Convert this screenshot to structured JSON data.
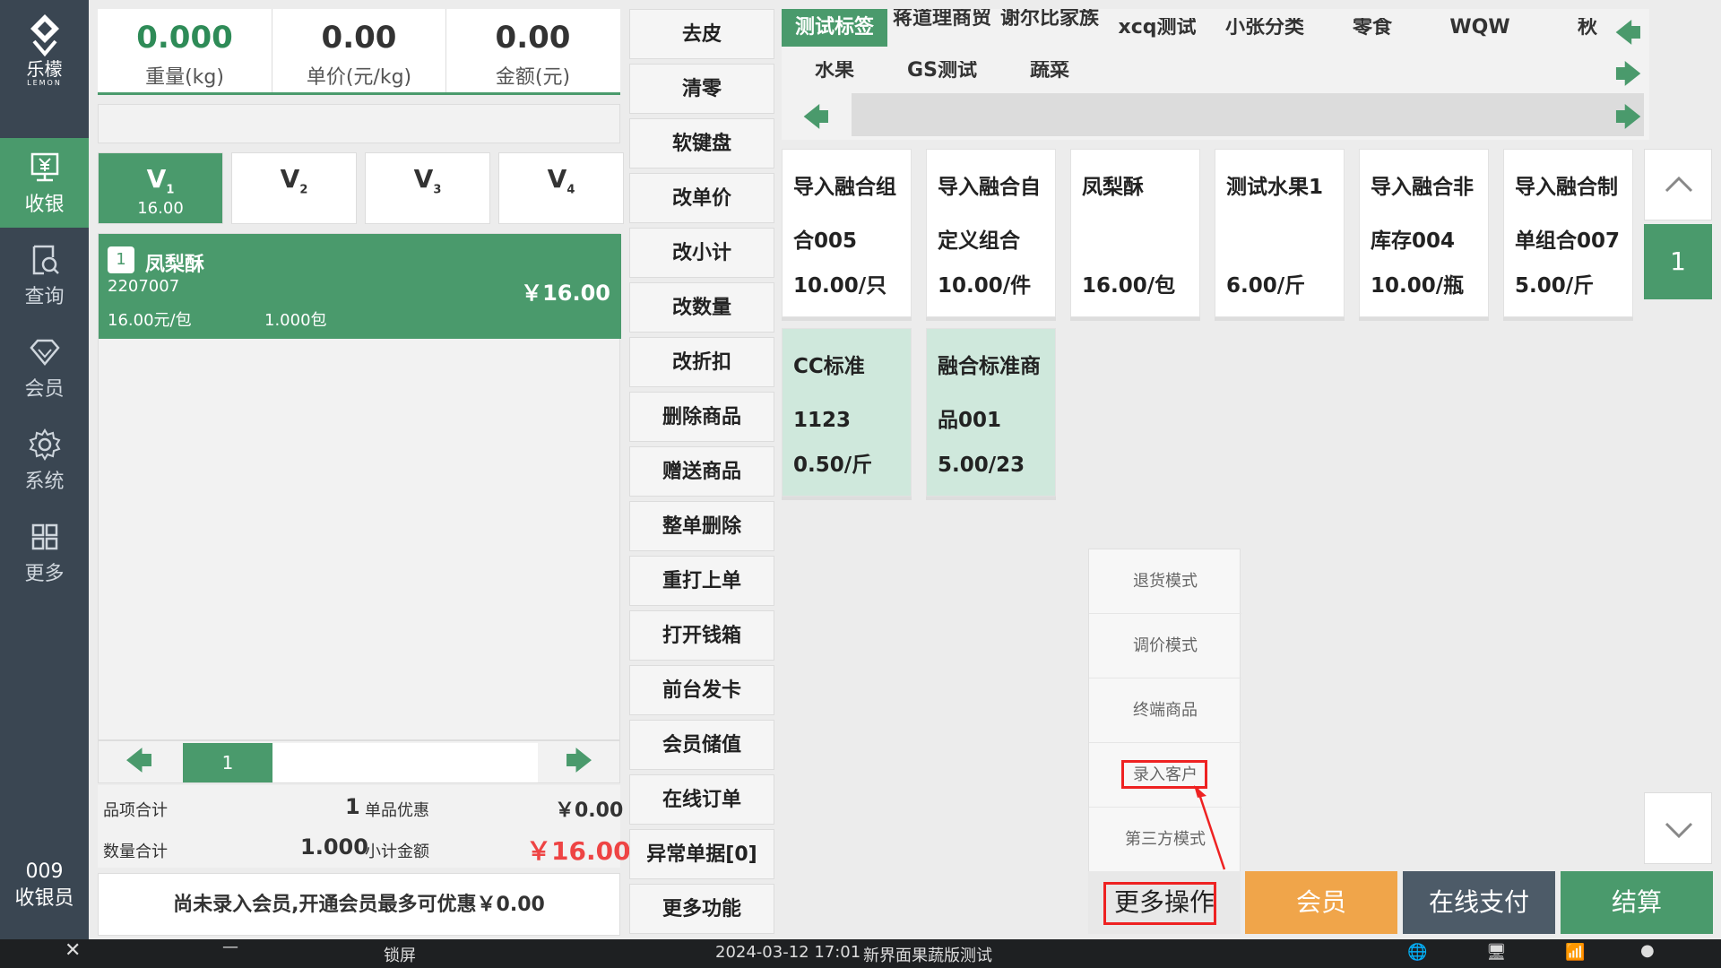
{
  "nav": {
    "brand_name": "乐檬",
    "brand_sub": "LEMON",
    "items": [
      {
        "label": "收银",
        "icon": "cashier-icon"
      },
      {
        "label": "查询",
        "icon": "query-icon"
      },
      {
        "label": "会员",
        "icon": "member-diamond-icon"
      },
      {
        "label": "系统",
        "icon": "gear-icon"
      },
      {
        "label": "更多",
        "icon": "grid-icon"
      }
    ],
    "cashier_id": "009",
    "cashier_label": "收银员"
  },
  "scale": {
    "weight_value": "0.000",
    "weight_label": "重量(kg)",
    "unit_price_value": "0.00",
    "unit_price_label": "单价(元/kg)",
    "amount_value": "0.00",
    "amount_label": "金额(元)",
    "weight_color": "#2e8b57"
  },
  "vtabs": [
    {
      "label": "V",
      "sub": "1",
      "sum": "16.00"
    },
    {
      "label": "V",
      "sub": "2",
      "sum": ""
    },
    {
      "label": "V",
      "sub": "3",
      "sum": ""
    },
    {
      "label": "V",
      "sub": "4",
      "sum": ""
    }
  ],
  "cart": {
    "items": [
      {
        "index": "1",
        "name": "凤梨酥",
        "code": "2207007",
        "price": "￥16.00",
        "unit_price": "16.00元/包",
        "qty": "1.000包"
      }
    ],
    "page": "1"
  },
  "totals": {
    "item_count_label": "品项合计",
    "item_count": "1",
    "single_discount_label": "单品优惠",
    "single_discount": "￥0.00",
    "qty_label": "数量合计",
    "qty": "1.000",
    "subtotal_label": "小计金额",
    "subtotal": "￥16.00"
  },
  "member_note": "尚未录入会员,开通会员最多可优惠￥0.00",
  "functions": [
    "去皮",
    "清零",
    "软键盘",
    "改单价",
    "改小计",
    "改数量",
    "改折扣",
    "删除商品",
    "赠送商品",
    "整单删除",
    "重打上单",
    "打开钱箱",
    "前台发卡",
    "会员储值",
    "在线订单",
    "异常单据[0]",
    "更多功能"
  ],
  "categories": {
    "row1": [
      "测试标签",
      "蒋道理商贸",
      "谢尔比家族",
      "xcq测试",
      "小张分类",
      "零食",
      "WQW",
      "秋"
    ],
    "row2": [
      "水果",
      "GS测试",
      "蔬菜"
    ]
  },
  "products": [
    {
      "name": "导入融合组合005",
      "price": "10.00/只",
      "green": false
    },
    {
      "name": "导入融合自定义组合0...",
      "price": "10.00/件",
      "green": false
    },
    {
      "name": "凤梨酥",
      "price": "16.00/包",
      "green": false
    },
    {
      "name": "测试水果1",
      "price": "6.00/斤",
      "green": false
    },
    {
      "name": "导入融合非库存004",
      "price": "10.00/瓶",
      "green": false
    },
    {
      "name": "导入融合制单组合007",
      "price": "5.00/斤",
      "green": false
    },
    {
      "name": "CC标准1123",
      "price": "0.50/斤",
      "green": true
    },
    {
      "name": "融合标准商品001",
      "price": "5.00/23",
      "green": true
    }
  ],
  "product_page": "1",
  "popup_menu": [
    "退货模式",
    "调价模式",
    "终端商品",
    "录入客户",
    "第三方模式"
  ],
  "actions": {
    "more_ops": "更多操作",
    "member": "会员",
    "online_pay": "在线支付",
    "checkout": "结算"
  },
  "colors": {
    "accent_green": "#4a9a6c",
    "member_orange": "#f0a54a",
    "online_pay_slate": "#4d5b68",
    "highlight_red": "#e22222",
    "product_green_bg": "#cfe8dc"
  },
  "taskbar": {
    "lock": "锁屏",
    "datetime": "2024-03-12 17:01",
    "store": "新界面果蔬版测试"
  }
}
